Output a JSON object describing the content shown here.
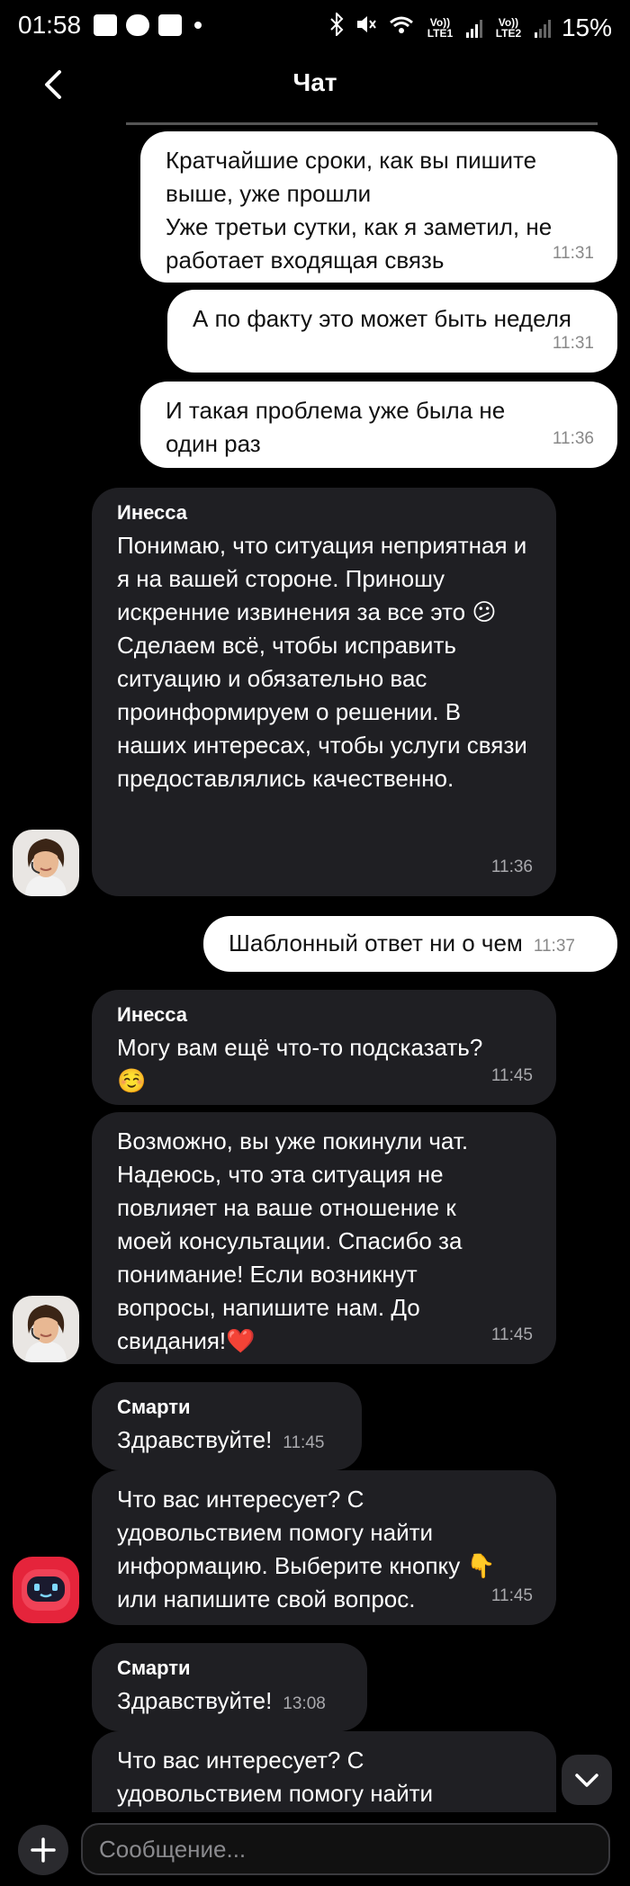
{
  "status_bar": {
    "time": "01:58",
    "sim1": "Vo)) LTE1",
    "sim2": "Vo)) LTE2",
    "battery": "15%"
  },
  "header": {
    "title": "Чат"
  },
  "messages": [
    {
      "text": "Кратчайшие сроки, как вы пишите выше, уже прошли\nУже третьи сутки, как я заметил, не работает входящая связь",
      "time": "11:31"
    },
    {
      "text": "А по факту это может быть неделя",
      "time": "11:31"
    },
    {
      "text": "И такая проблема уже была не один раз",
      "time": "11:36"
    },
    {
      "sender": "Инесса",
      "text": "Понимаю, что ситуация неприятная и я на вашей стороне. Приношу искренние извинения за все это 😕 Сделаем всё, чтобы исправить ситуацию и обязательно вас проинформируем о решении. В наших интересах, чтобы услуги связи предоставлялись качественно.",
      "time": "11:36"
    },
    {
      "text": "Шаблонный ответ ни о чем",
      "time": "11:37"
    },
    {
      "sender": "Инесса",
      "text": "Могу вам ещё что-то подсказать? ☺️",
      "time": "11:45"
    },
    {
      "text": "Возможно, вы уже покинули чат. Надеюсь, что эта ситуация не повлияет на ваше отношение к моей консультации. Спасибо за понимание! Если возникнут вопросы, напишите нам. До свидания!❤️",
      "time": "11:45"
    },
    {
      "sender": "Смарти",
      "text": "Здравствуйте!",
      "time": "11:45"
    },
    {
      "text": "Что вас интересует? С удовольствием помогу найти информацию. Выберите кнопку 👇 или напишите свой вопрос.",
      "time": "11:45"
    },
    {
      "sender": "Смарти",
      "text": "Здравствуйте!",
      "time": "13:08"
    },
    {
      "text": "Что вас интересует? С удовольствием помогу найти"
    }
  ],
  "input": {
    "placeholder": "Сообщение..."
  }
}
